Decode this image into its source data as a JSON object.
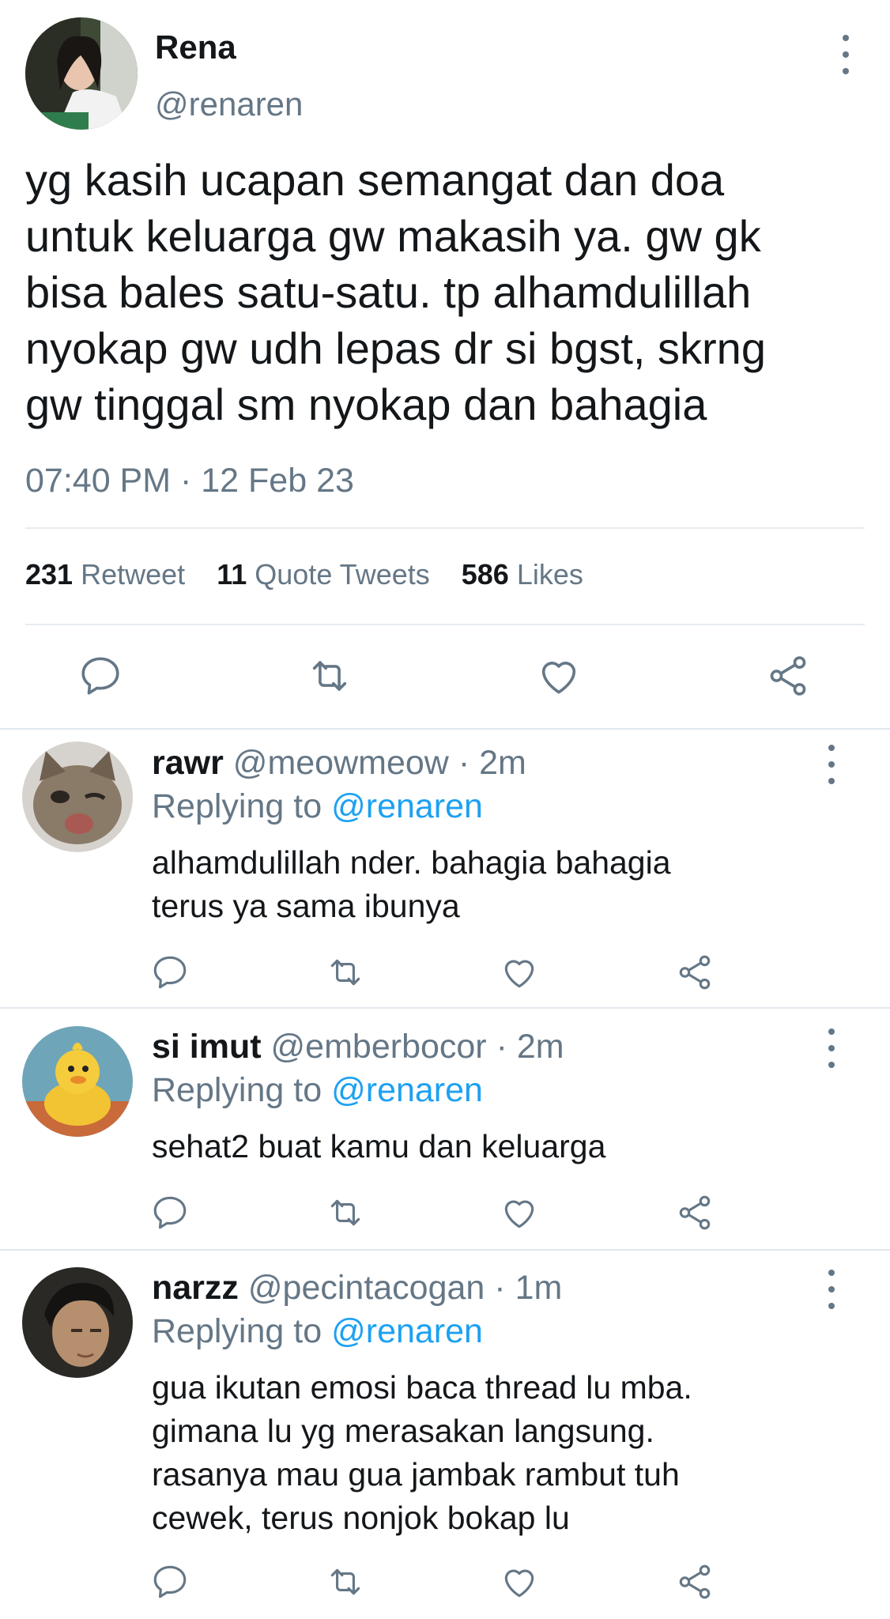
{
  "tweet": {
    "name": "Rena",
    "handle": "@renaren",
    "lines": [
      "yg kasih ucapan semangat dan doa",
      "untuk keluarga gw makasih ya. gw gk",
      "bisa bales satu-satu. tp alhamdulillah",
      "nyokap gw udh lepas dr si bgst, skrng",
      "gw tinggal sm nyokap dan bahagia"
    ],
    "timestamp": "07:40 PM · 12 Feb 23",
    "stats": {
      "retweets_count": "231",
      "retweets_label": "Retweet",
      "quotes_count": "11",
      "quotes_label": "Quote Tweets",
      "likes_count": "586",
      "likes_label": "Likes"
    }
  },
  "replying_label": "Replying to",
  "replies": [
    {
      "name": "rawr",
      "handle": "@meowmeow",
      "time": "· 2m",
      "replying_to": "@renaren",
      "lines": [
        "alhamdulillah nder. bahagia bahagia",
        "terus ya sama ibunya"
      ]
    },
    {
      "name": "si imut",
      "handle": "@emberbocor",
      "time": "· 2m",
      "replying_to": "@renaren",
      "lines": [
        "sehat2 buat kamu dan keluarga"
      ]
    },
    {
      "name": "narzz",
      "handle": "@pecintacogan",
      "time": "· 1m",
      "replying_to": "@renaren",
      "lines": [
        "gua ikutan emosi baca thread lu mba.",
        "gimana lu yg merasakan langsung.",
        "rasanya mau gua jambak rambut tuh",
        "cewek, terus nonjok bokap lu"
      ]
    }
  ],
  "icons": {
    "reply": "reply-icon",
    "retweet": "retweet-icon",
    "like": "like-icon",
    "share": "share-icon",
    "more": "more-options-icon"
  },
  "colors": {
    "link": "#1da1f2",
    "secondary": "#657786",
    "text": "#14171a"
  }
}
